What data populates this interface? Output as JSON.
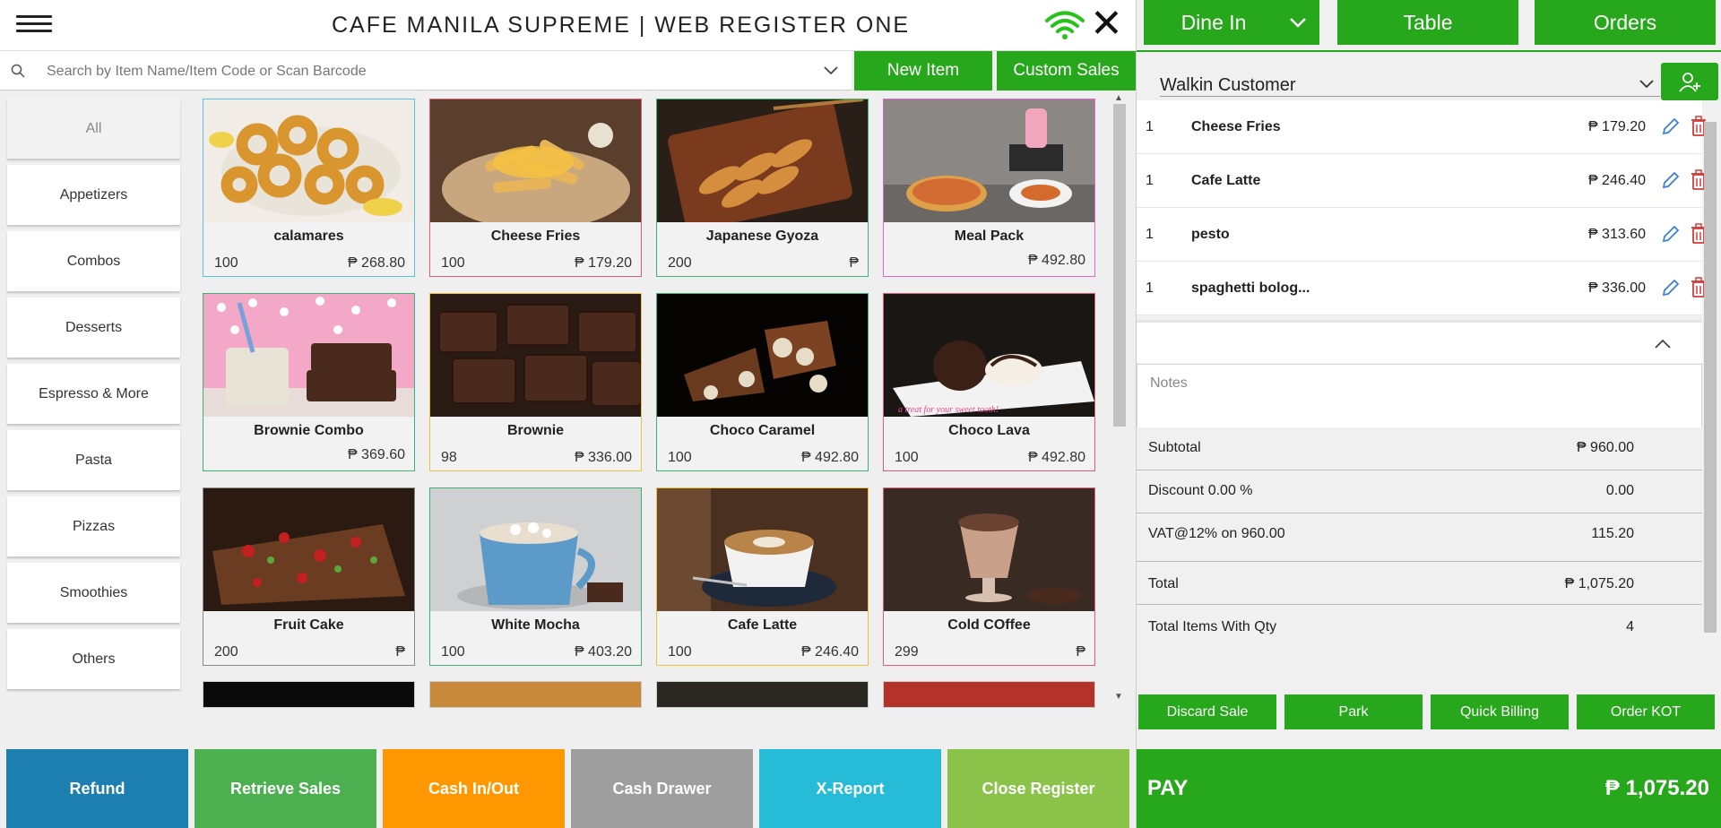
{
  "header": {
    "title": "CAFE MANILA SUPREME | WEB REGISTER ONE"
  },
  "search": {
    "placeholder": "Search by Item Name/Item Code or Scan Barcode"
  },
  "toolbar": {
    "new_item": "New Item",
    "custom_sales": "Custom Sales"
  },
  "categories": [
    "All",
    "Appetizers",
    "Combos",
    "Desserts",
    "Espresso & More",
    "Pasta",
    "Pizzas",
    "Smoothies",
    "Others"
  ],
  "products": [
    {
      "name": "calamares",
      "stock": "100",
      "price": "₱ 268.80",
      "border": "#5bc0de"
    },
    {
      "name": "Cheese Fries",
      "stock": "100",
      "price": "₱ 179.20",
      "border": "#e05a7a"
    },
    {
      "name": "Japanese Gyoza",
      "stock": "200",
      "price": "₱",
      "border": "#3cb371"
    },
    {
      "name": "Meal Pack",
      "stock": "",
      "price": "₱ 492.80",
      "border": "#e066c8"
    },
    {
      "name": "Brownie Combo",
      "stock": "",
      "price": "₱ 369.60",
      "border": "#3cb371"
    },
    {
      "name": "Brownie",
      "stock": "98",
      "price": "₱ 336.00",
      "border": "#f0c040"
    },
    {
      "name": "Choco Caramel",
      "stock": "100",
      "price": "₱ 492.80",
      "border": "#3cb371"
    },
    {
      "name": "Choco Lava",
      "stock": "100",
      "price": "₱ 492.80",
      "border": "#e05a7a"
    },
    {
      "name": "Fruit Cake",
      "stock": "200",
      "price": "₱",
      "border": "#888888"
    },
    {
      "name": "White Mocha",
      "stock": "100",
      "price": "₱ 403.20",
      "border": "#3cb371"
    },
    {
      "name": "Cafe Latte",
      "stock": "100",
      "price": "₱ 246.40",
      "border": "#f0c040"
    },
    {
      "name": "Cold COffee",
      "stock": "299",
      "price": "₱",
      "border": "#e05a7a"
    }
  ],
  "bottom_buttons": [
    {
      "label": "Refund",
      "color": "#1c7fb0"
    },
    {
      "label": "Retrieve Sales",
      "color": "#4caf50"
    },
    {
      "label": "Cash In/Out",
      "color": "#ff9800"
    },
    {
      "label": "Cash Drawer",
      "color": "#9e9e9e"
    },
    {
      "label": "X-Report",
      "color": "#26bcd7"
    },
    {
      "label": "Close Register",
      "color": "#8bc34a"
    }
  ],
  "order_header": {
    "dine_in": "Dine In",
    "table": "Table",
    "orders": "Orders"
  },
  "customer": {
    "name": "Walkin Customer"
  },
  "cart": [
    {
      "qty": "1",
      "name": "Cheese Fries",
      "price": "₱ 179.20"
    },
    {
      "qty": "1",
      "name": "Cafe Latte",
      "price": "₱ 246.40"
    },
    {
      "qty": "1",
      "name": "pesto",
      "price": "₱ 313.60"
    },
    {
      "qty": "1",
      "name": "spaghetti bolog...",
      "price": "₱ 336.00"
    }
  ],
  "notes_placeholder": "Notes",
  "summary": {
    "subtotal_label": "Subtotal",
    "subtotal": "₱ 960.00",
    "discount_label": "Discount 0.00 %",
    "discount": "0.00",
    "vat_label": "VAT@12% on 960.00",
    "vat": "115.20",
    "total_label": "Total",
    "total": "₱ 1,075.20",
    "items_label": "Total Items With Qty",
    "items": "4"
  },
  "actions": [
    "Discard Sale",
    "Park",
    "Quick Billing",
    "Order KOT"
  ],
  "pay": {
    "label": "PAY",
    "amount": "₱ 1,075.20"
  },
  "colors": {
    "accent": "#27a71b",
    "edit": "#3b82d6",
    "delete": "#d33b3b"
  }
}
